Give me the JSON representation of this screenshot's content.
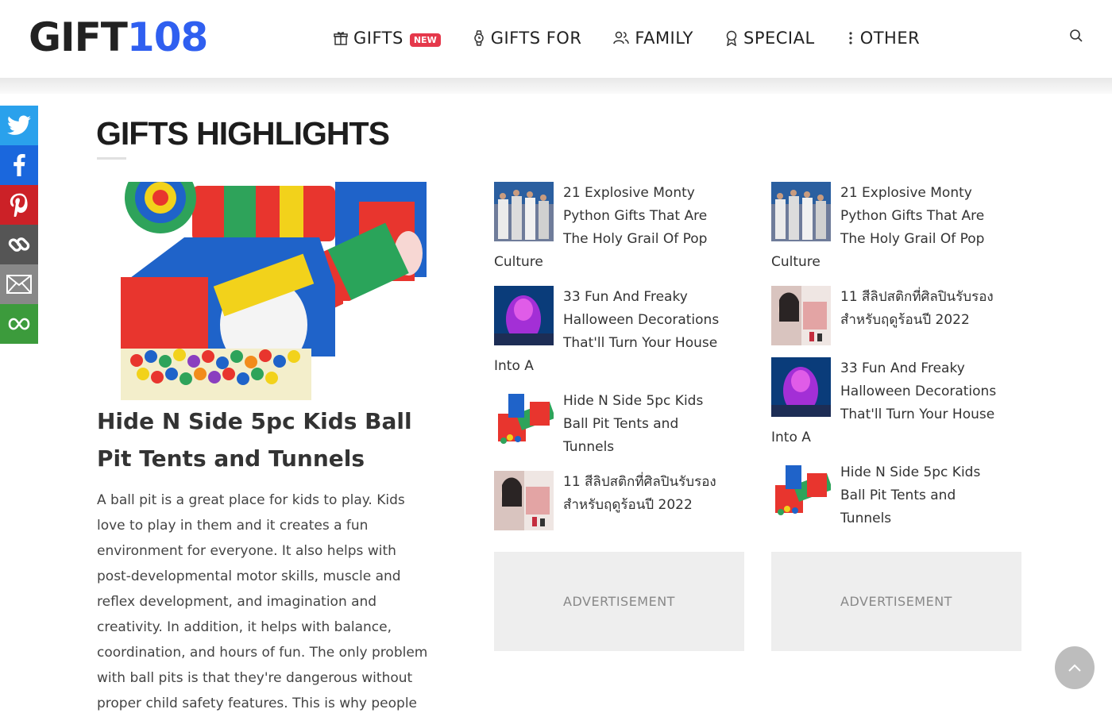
{
  "header": {
    "logo_part1": "GIFT",
    "logo_part2": "108",
    "nav": [
      {
        "label": "GIFTS",
        "badge": "NEW",
        "icon": "gift-icon"
      },
      {
        "label": "GIFTS FOR",
        "icon": "watch-icon"
      },
      {
        "label": "FAMILY",
        "icon": "users-icon"
      },
      {
        "label": "SPECIAL",
        "icon": "award-icon"
      },
      {
        "label": "OTHER",
        "icon": "more-vertical-icon"
      }
    ],
    "search_icon": "search-icon"
  },
  "share": [
    {
      "name": "twitter",
      "color": "#2aa1ec"
    },
    {
      "name": "facebook",
      "color": "#1a67dd"
    },
    {
      "name": "pinterest",
      "color": "#cc2127"
    },
    {
      "name": "copy-link",
      "color": "#555555"
    },
    {
      "name": "email",
      "color": "#888888"
    },
    {
      "name": "more",
      "color": "#3c9b3c"
    }
  ],
  "section": {
    "title": "GIFTS HIGHLIGHTS"
  },
  "featured": {
    "title": "Hide N Side 5pc Kids Ball Pit Tents and Tunnels",
    "body": "A ball pit is a great place for kids to play. Kids love to play in them and it creates a fun environment for everyone. It also helps with post-developmental motor skills, muscle and reflex development, and imagination and creativity. In addition, it helps with balance, coordination, and hours of fun. The only problem with ball pits is that they're dangerous without proper child safety features. This is why people"
  },
  "list_a": [
    {
      "title": "21 Explosive Monty Python Gifts That Are The Holy Grail Of Pop Culture",
      "thumb": "monty"
    },
    {
      "title": "33 Fun And Freaky Halloween Decorations That'll Turn Your House Into A",
      "thumb": "halloween"
    },
    {
      "title": "Hide N Side 5pc Kids Ball Pit Tents and Tunnels",
      "thumb": "ballpit"
    },
    {
      "title": "11 สีลิปสติกที่ศิลปินรับรองสำหรับฤดูร้อนปี 2022",
      "thumb": "lipstick"
    }
  ],
  "list_b": [
    {
      "title": "21 Explosive Monty Python Gifts That Are The Holy Grail Of Pop Culture",
      "thumb": "monty"
    },
    {
      "title": "11 สีลิปสติกที่ศิลปินรับรองสำหรับฤดูร้อนปี 2022",
      "thumb": "lipstick"
    },
    {
      "title": "33 Fun And Freaky Halloween Decorations That'll Turn Your House Into A",
      "thumb": "halloween"
    },
    {
      "title": "Hide N Side 5pc Kids Ball Pit Tents and Tunnels",
      "thumb": "ballpit"
    }
  ],
  "ads": {
    "label": "ADVERTISEMENT"
  },
  "colors": {
    "brand_blue": "#2f5ff0",
    "badge_red": "#e5384b"
  }
}
